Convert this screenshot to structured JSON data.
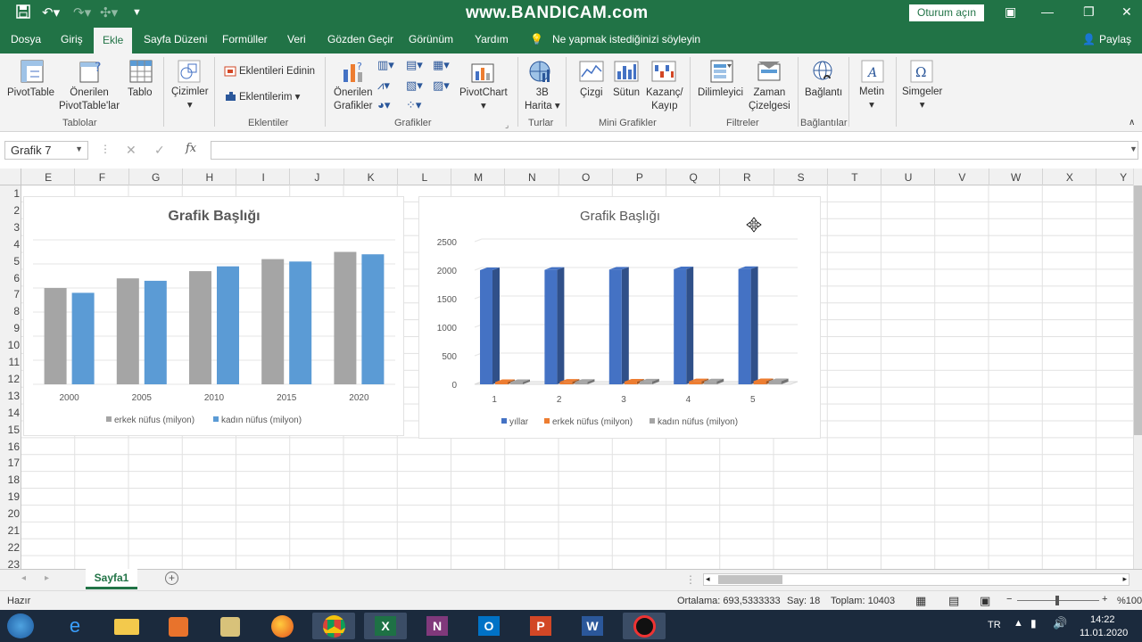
{
  "window": {
    "watermark": "www.BANDICAM.com",
    "signin_label": "Oturum açın",
    "share_label": "Paylaş"
  },
  "tabs": [
    "Dosya",
    "Giriş",
    "Ekle",
    "Sayfa Düzeni",
    "Formüller",
    "Veri",
    "Gözden Geçir",
    "Görünüm",
    "Yardım"
  ],
  "active_tab": "Ekle",
  "tell_me": "Ne yapmak istediğinizi söyleyin",
  "ribbon": {
    "pivottable": "PivotTable",
    "recommended_pivot_1": "Önerilen",
    "recommended_pivot_2": "PivotTable'lar",
    "table": "Tablo",
    "group_tables": "Tablolar",
    "drawings": "Çizimler",
    "get_addins": "Eklentileri Edinin",
    "my_addins": "Eklentilerim",
    "group_addins": "Eklentiler",
    "rec_charts_1": "Önerilen",
    "rec_charts_2": "Grafikler",
    "pivotchart": "PivotChart",
    "group_charts": "Grafikler",
    "map3d_1": "3B",
    "map3d_2": "Harita",
    "group_tours": "Turlar",
    "spark_line": "Çizgi",
    "spark_column": "Sütun",
    "spark_winloss_1": "Kazanç/",
    "spark_winloss_2": "Kayıp",
    "group_sparklines": "Mini Grafikler",
    "slicer": "Dilimleyici",
    "timeline_1": "Zaman",
    "timeline_2": "Çizelgesi",
    "group_filters": "Filtreler",
    "link": "Bağlantı",
    "group_links": "Bağlantılar",
    "text": "Metin",
    "symbols": "Simgeler"
  },
  "formula_bar": {
    "name_box": "Grafik 7",
    "fx": "fx",
    "formula": ""
  },
  "columns": [
    "E",
    "F",
    "G",
    "H",
    "I",
    "J",
    "K",
    "L",
    "M",
    "N",
    "O",
    "P",
    "Q",
    "R",
    "S",
    "T",
    "U",
    "V",
    "W",
    "X",
    "Y"
  ],
  "rows": [
    "1",
    "2",
    "3",
    "4",
    "5",
    "6",
    "7",
    "8",
    "9",
    "10",
    "11",
    "12",
    "13",
    "14",
    "15",
    "16",
    "17",
    "18",
    "19",
    "20",
    "21",
    "22",
    "23"
  ],
  "chart_data": [
    {
      "type": "bar",
      "title": "Grafik Başlığı",
      "categories": [
        "2000",
        "2005",
        "2010",
        "2015",
        "2020"
      ],
      "series": [
        {
          "name": "erkek nüfus (milyon)",
          "values": [
            40,
            44,
            47,
            52,
            55
          ],
          "color": "#a5a5a5"
        },
        {
          "name": "kadın nüfus (milyon)",
          "values": [
            38,
            43,
            49,
            51,
            54
          ],
          "color": "#5b9bd5"
        }
      ],
      "ylim": [
        0,
        60
      ],
      "grid": true,
      "legend": "bottom"
    },
    {
      "type": "bar",
      "title": "Grafik Başlığı",
      "categories": [
        "1",
        "2",
        "3",
        "4",
        "5"
      ],
      "series": [
        {
          "name": "yıllar",
          "values": [
            2000,
            2005,
            2010,
            2015,
            2020
          ],
          "color": "#4472c4"
        },
        {
          "name": "erkek nüfus (milyon)",
          "values": [
            40,
            44,
            47,
            52,
            55
          ],
          "color": "#ed7d31"
        },
        {
          "name": "kadın nüfus (milyon)",
          "values": [
            38,
            43,
            49,
            51,
            54
          ],
          "color": "#a5a5a5"
        }
      ],
      "yticks": [
        "0",
        "500",
        "1000",
        "1500",
        "2000",
        "2500"
      ],
      "ylim": [
        0,
        2500
      ],
      "grid": true,
      "legend": "bottom",
      "style": "3d"
    }
  ],
  "sheets": [
    "Sayfa1"
  ],
  "status": {
    "ready": "Hazır",
    "average": "Ortalama: 693,5333333",
    "count": "Say: 18",
    "sum": "Toplam: 10403",
    "zoom": "%100"
  },
  "taskbar": {
    "lang": "TR",
    "time": "14:22",
    "date": "11.01.2020"
  },
  "colors": {
    "excel_green": "#217346",
    "taskbar": "#1b2a3d"
  }
}
